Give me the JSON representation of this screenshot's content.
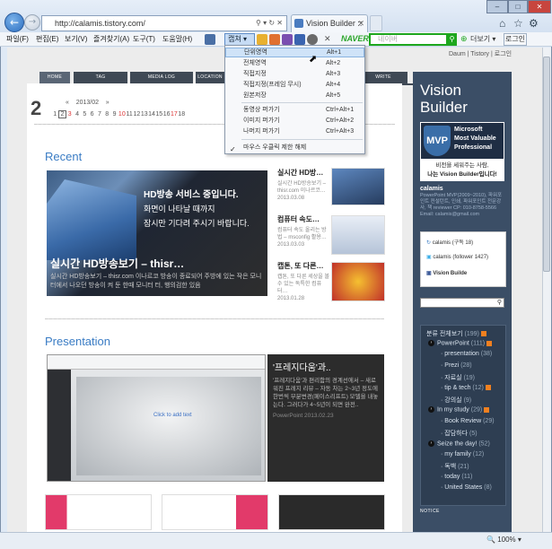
{
  "browser": {
    "url": "http://calamis.tistory.com/",
    "tab_title": "Vision Builder ::",
    "zoom": "100%"
  },
  "menu": [
    "파일(F)",
    "편집(E)",
    "보기(V)",
    "즐겨찾기(A)",
    "도구(T)",
    "도움말(H)"
  ],
  "toolbar": {
    "capture": "캡쳐",
    "naver": "NAVER",
    "search_placeholder": "네이버",
    "more": "더보기",
    "login": "로그인"
  },
  "dropdown": [
    {
      "label": "단위영역",
      "key": "Alt+1"
    },
    {
      "label": "전체영역",
      "key": "Alt+2"
    },
    {
      "label": "직접지정",
      "key": "Alt+3"
    },
    {
      "label": "직접지정(프레임 무시)",
      "key": "Alt+4"
    },
    {
      "label": "원본저장",
      "key": "Alt+5"
    },
    {
      "label": "동영상 퍼가기",
      "key": "Ctrl+Alt+1"
    },
    {
      "label": "이미지 퍼가기",
      "key": "Ctrl+Alt+2"
    },
    {
      "label": "나머지 퍼가기",
      "key": "Ctrl+Alt+3"
    },
    {
      "label": "마우스 우클릭 제한 해제",
      "key": ""
    }
  ],
  "topnav": {
    "daum": "Daum",
    "tistory": "Tistory",
    "login": "로그인"
  },
  "tabs": [
    "HOME",
    "TAG",
    "MEDIA LOG",
    "LOCATION LOG",
    "WRITE"
  ],
  "calendar": {
    "day": "2",
    "ym": "2013/02",
    "prev": "«",
    "next": "»",
    "days": [
      "1",
      "2",
      "3",
      "4",
      "5",
      "6",
      "7",
      "8",
      "9",
      "10",
      "11",
      "12",
      "13",
      "14",
      "15",
      "16",
      "17",
      "18"
    ]
  },
  "recent": {
    "title": "Recent",
    "hero_text": "HD방송 서비스 중입니다.",
    "hero_sub1": "화면이 나타날 때까지",
    "hero_sub2": "잠시만 기다려 주시기 바랍니다.",
    "hero_caption": "실시간 HD방송보기 – thisr…",
    "hero_desc": "실시간 HD방송보기 – thisr.com 이나르코 방송이 종료되어 주방에 있는 작은 모니터에서 나오던 방송이 켜 둔 한때 모니터 터, 행의검한 있음",
    "posts": [
      {
        "title": "실시간 HD방…",
        "desc": "실시간 HD방송보기 – thisr.com 이나르코…",
        "date": "2013.03.08"
      },
      {
        "title": "컴퓨터 속도…",
        "desc": "컴퓨터 속도 올리는 방법 – msconfig 활용…",
        "date": "2013.03.03"
      },
      {
        "title": "캡톤, 또 다른…",
        "desc": "캡톤, 또 다른 세상을 볼 수 있는 독특한 컴퓨터…",
        "date": "2013.01.28"
      }
    ]
  },
  "presentation": {
    "title": "Presentation",
    "click": "Click to add text",
    "side_title": "'프레지다움'과..",
    "side_desc": "'프레지다움'과 편리함의 경계선에서 – 새로워진 프레지 리뷰 – 자동 차는 2~3년 정도에 한번씩 부분변경(페이스리프트) 모델을 내놓는다. 그러다가 4~5년이 되면 완전..",
    "side_meta": "PowerPoint 2013.02.23"
  },
  "sidebar": {
    "title_l1": "Vision",
    "title_l2": "Builder",
    "mvp1": "Microsoft",
    "mvp2": "Most Valuable",
    "mvp3": "Professional",
    "mvp_logo": "MVP",
    "vision1": "비전을 세워주는 사람,",
    "vision2": "나는 Vision Builder입니다!",
    "name": "calamis",
    "info": "PowerPoint MVP(2009~2010), 파워포인트 컨설턴트, 인쇄, 파워포인트 전문강사, 책 reviewer CP: 010-8758-5566 Email: calamis@gmail.com",
    "social": [
      {
        "t": "calamis (구독 18)"
      },
      {
        "t": "calamis (follower 1427)"
      },
      {
        "t": "Vision Builde"
      }
    ],
    "cat_head": "분류 전체보기",
    "cat_head_n": "(199)",
    "cats": [
      {
        "l": "PowerPoint",
        "n": "(111)",
        "lvl": 0,
        "rss": true
      },
      {
        "l": "presentation",
        "n": "(38)",
        "lvl": 1
      },
      {
        "l": "Prezi",
        "n": "(28)",
        "lvl": 1
      },
      {
        "l": "자료실",
        "n": "(19)",
        "lvl": 1
      },
      {
        "l": "tip & tech",
        "n": "(12)",
        "lvl": 1,
        "rss": true
      },
      {
        "l": "강의실",
        "n": "(9)",
        "lvl": 1
      },
      {
        "l": "In my study",
        "n": "(29)",
        "lvl": 0,
        "rss": true
      },
      {
        "l": "Book Review",
        "n": "(29)",
        "lvl": 1
      },
      {
        "l": "잡담하다",
        "n": "(5)",
        "lvl": 1
      },
      {
        "l": "Seize the day!",
        "n": "(52)",
        "lvl": 0
      },
      {
        "l": "my family",
        "n": "(12)",
        "lvl": 1
      },
      {
        "l": "독백",
        "n": "(21)",
        "lvl": 1
      },
      {
        "l": "today",
        "n": "(11)",
        "lvl": 1
      },
      {
        "l": "United States",
        "n": "(8)",
        "lvl": 1
      }
    ],
    "notice": "NOTICE"
  }
}
